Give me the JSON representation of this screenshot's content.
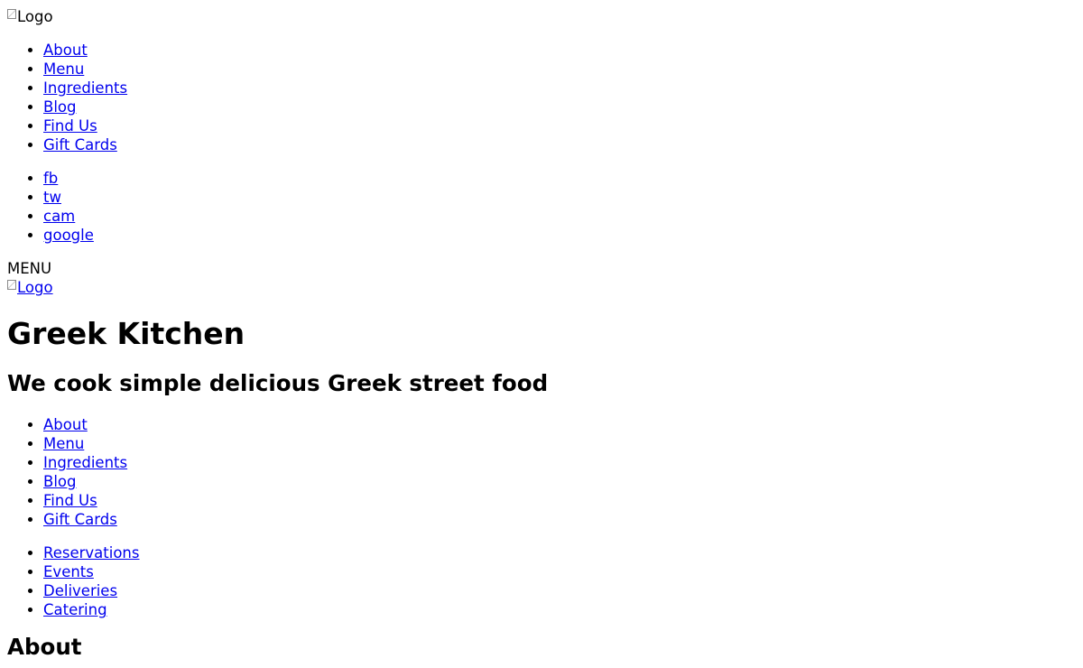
{
  "header": {
    "logo_alt": "Logo",
    "nav": [
      "About",
      "Menu",
      "Ingredients",
      "Blog",
      "Find Us",
      "Gift Cards"
    ],
    "social": [
      "fb",
      "tw",
      "cam",
      "google"
    ],
    "menu_label": "MENU",
    "logo_link_alt": "Logo"
  },
  "hero": {
    "title": "Greek Kitchen",
    "tagline": "We cook simple delicious Greek street food"
  },
  "main_nav": [
    "About",
    "Menu",
    "Ingredients",
    "Blog",
    "Find Us",
    "Gift Cards"
  ],
  "services": [
    "Reservations",
    "Events",
    "Deliveries",
    "Catering"
  ],
  "sections": {
    "about_heading": "About"
  },
  "colors": {
    "link": "#0000ee",
    "text": "#000000",
    "background": "#ffffff"
  }
}
